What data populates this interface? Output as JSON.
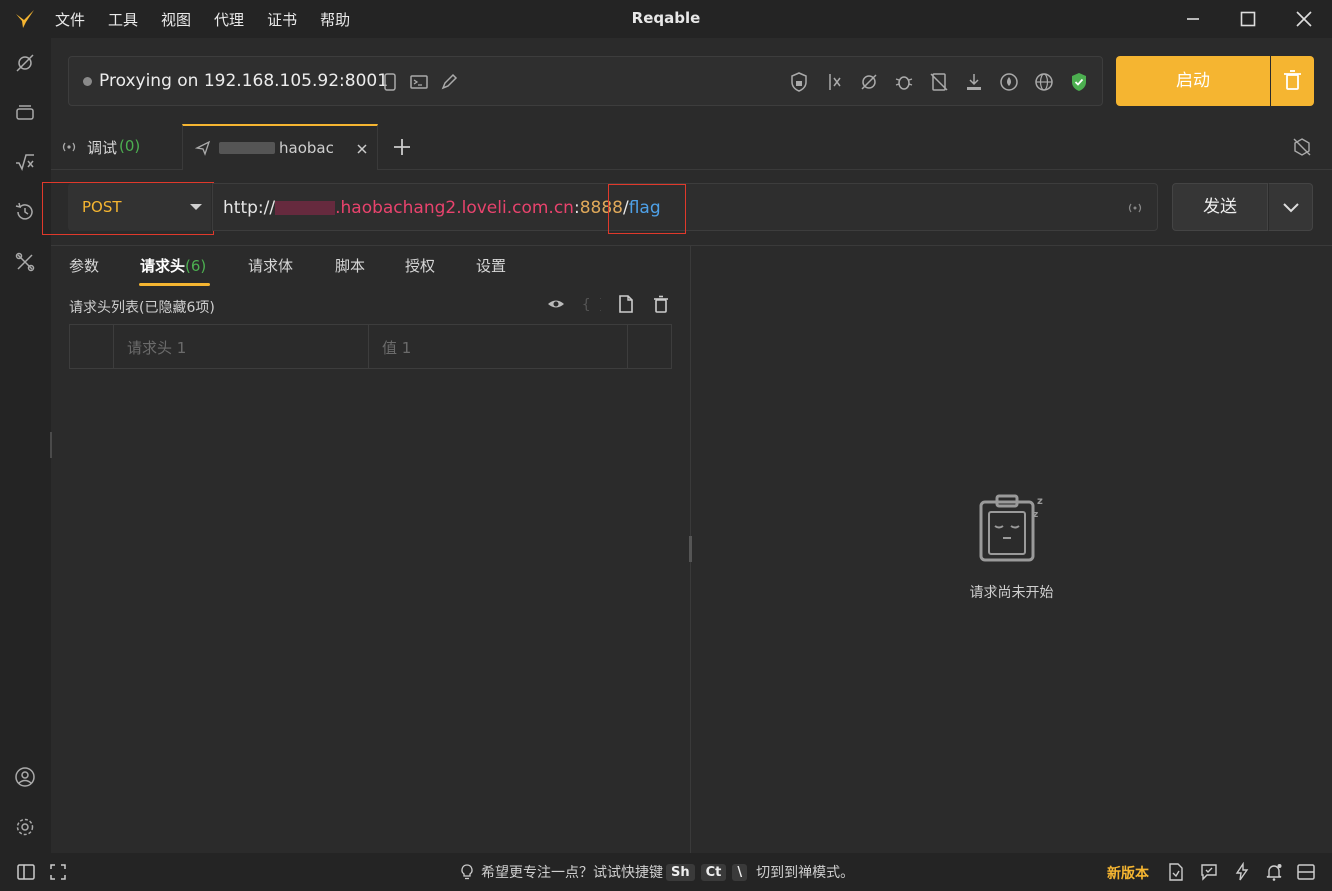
{
  "app": {
    "title": "Reqable"
  },
  "menu": [
    "文件",
    "工具",
    "视图",
    "代理",
    "证书",
    "帮助"
  ],
  "proxy": {
    "status_text": "Proxying on 192.168.105.92:8001",
    "start_label": "启动"
  },
  "tabs": {
    "debug_label": "调试",
    "debug_count": "(0)",
    "active_label": "haobac"
  },
  "request": {
    "method": "POST",
    "url_scheme": "http://",
    "url_host": ".haobachang2.loveli.com.cn",
    "url_port_sep": ":",
    "url_port": "8888",
    "url_slash": "/",
    "url_path": "flag",
    "send_label": "发送"
  },
  "subtabs": {
    "params": "参数",
    "headers": "请求头",
    "headers_count": "(6)",
    "body": "请求体",
    "script": "脚本",
    "auth": "授权",
    "settings": "设置"
  },
  "headers_panel": {
    "list_label": "请求头列表(已隐藏6项)",
    "name_placeholder": "请求头 1",
    "value_placeholder": "值 1"
  },
  "response": {
    "empty_text": "请求尚未开始"
  },
  "status_bar": {
    "hint_prefix": "希望更专注一点？试试快捷键",
    "key1": "Sh",
    "key2": "Ct",
    "key3": "\\",
    "hint_suffix": "切到到禅模式。",
    "new_version": "新版本"
  },
  "colors": {
    "accent": "#f5b531",
    "url_host": "#e8436d",
    "url_port": "#e0a95a",
    "url_path": "#4ea1e8",
    "success": "#4caf50",
    "highlight_box": "#e0392b"
  }
}
